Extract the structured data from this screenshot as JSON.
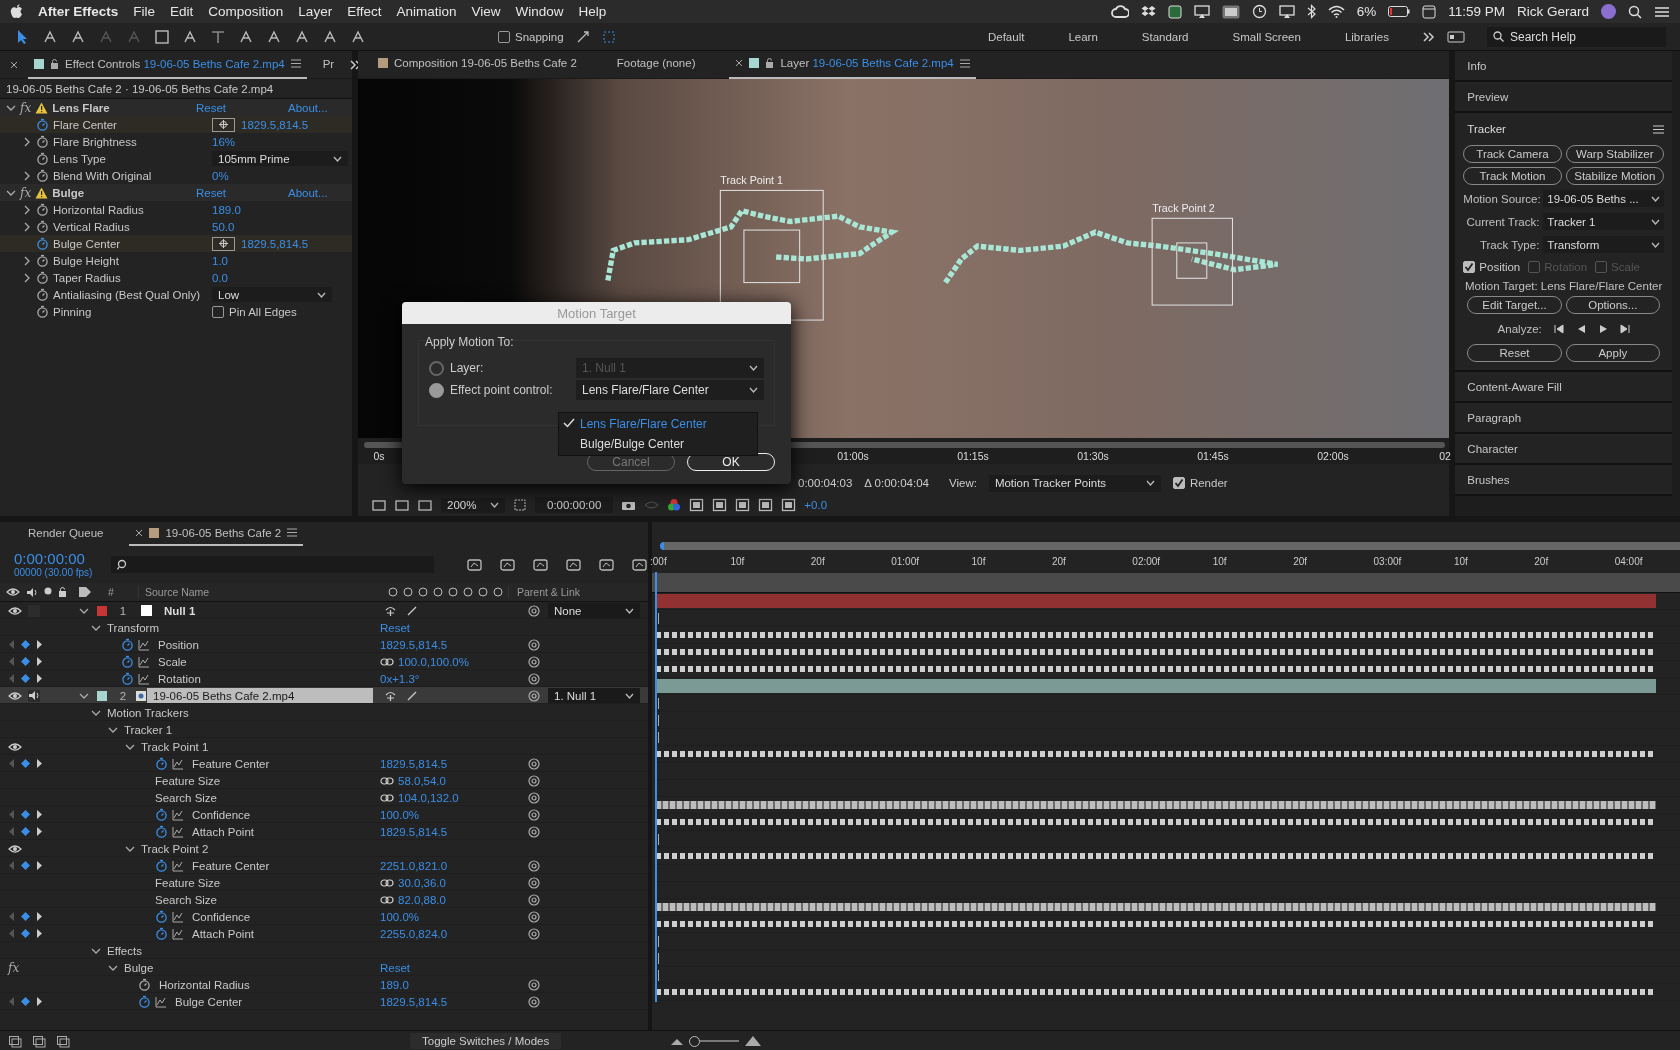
{
  "menu_bar": {
    "app_name": "After Effects",
    "items": [
      "File",
      "Edit",
      "Composition",
      "Layer",
      "Effect",
      "Animation",
      "View",
      "Window",
      "Help"
    ],
    "battery": "6%",
    "clock": "11:59 PM",
    "user": "Rick Gerard"
  },
  "toolbar": {
    "snapping": {
      "label": "Snapping",
      "checked": false
    },
    "workspaces": [
      "Default",
      "Learn",
      "Standard",
      "Small Screen",
      "Libraries"
    ],
    "search": {
      "placeholder": "Search Help"
    }
  },
  "effect_controls": {
    "tab": {
      "label": "Effect Controls",
      "clip": "19-06-05 Beths Cafe 2.mp4"
    },
    "next_tab": "Pr",
    "breadcrumb": "19-06-05 Beths Cafe 2 · 19-06-05 Beths Cafe 2.mp4",
    "effects": [
      {
        "badge": "fx",
        "name": "Lens Flare",
        "expanded": true,
        "reset": "Reset",
        "about": "About...",
        "properties": [
          {
            "kind": "point",
            "name": "Flare Center",
            "value": "1829.5,814.5",
            "animated": true
          },
          {
            "kind": "number",
            "name": "Flare Brightness",
            "value": "16%",
            "animated": false
          },
          {
            "kind": "select",
            "name": "Lens Type",
            "value": "105mm Prime",
            "animated": false
          },
          {
            "kind": "number",
            "name": "Blend With Original",
            "value": "0%",
            "animated": false
          }
        ]
      },
      {
        "badge": "fx",
        "name": "Bulge",
        "expanded": true,
        "reset": "Reset",
        "about": "About...",
        "properties": [
          {
            "kind": "number",
            "name": "Horizontal Radius",
            "value": "189.0",
            "animated": false
          },
          {
            "kind": "number",
            "name": "Vertical Radius",
            "value": "50.0",
            "animated": false
          },
          {
            "kind": "point",
            "name": "Bulge Center",
            "value": "1829.5,814.5",
            "animated": true
          },
          {
            "kind": "number",
            "name": "Bulge Height",
            "value": "1.0",
            "animated": false
          },
          {
            "kind": "number",
            "name": "Taper Radius",
            "value": "0.0",
            "animated": false
          },
          {
            "kind": "select",
            "name": "Antialiasing (Best Qual Only)",
            "value": "Low",
            "animated": false
          },
          {
            "kind": "checkbox",
            "name": "Pinning",
            "value": "Pin All Edges",
            "checked": false,
            "animated": false
          }
        ]
      }
    ]
  },
  "viewer": {
    "tabs": [
      {
        "kind": "composition",
        "label": "Composition 19-06-05 Beths Cafe 2",
        "selected": false
      },
      {
        "kind": "footage",
        "label": "Footage (none)",
        "selected": false
      },
      {
        "kind": "layer",
        "label": "Layer",
        "clip": "19-06-05 Beths Cafe 2.mp4",
        "selected": true
      }
    ],
    "track_points": [
      {
        "label": "Track Point 1"
      },
      {
        "label": "Track Point 2"
      }
    ],
    "ruler": [
      "0s",
      "01:00s",
      "01:15s",
      "01:30s",
      "01:45s",
      "02:00s",
      "02"
    ],
    "info": {
      "current": "0:00:04:03",
      "duration": "Δ 0:00:04:04",
      "view_label": "View:",
      "view": "Motion Tracker Points",
      "render": {
        "label": "Render",
        "checked": true
      }
    },
    "toolbar": {
      "zoom": "200%",
      "timecode": "0:00:00:00",
      "exposure": "+0.0"
    }
  },
  "dialog": {
    "title": "Motion Target",
    "group_label": "Apply Motion To:",
    "options": [
      {
        "label": "Layer:",
        "selected": false,
        "disabled": true,
        "value": "1. Null 1"
      },
      {
        "label": "Effect point control:",
        "selected": true,
        "disabled": false,
        "value": "Lens Flare/Flare Center"
      }
    ],
    "menu": [
      {
        "label": "Lens Flare/Flare Center",
        "selected": true
      },
      {
        "label": "Bulge/Bulge Center",
        "selected": false
      }
    ],
    "buttons": [
      {
        "label": "Cancel",
        "default": false
      },
      {
        "label": "OK",
        "default": true
      }
    ]
  },
  "right_panel": {
    "sections_top": [
      "Info",
      "Preview"
    ],
    "tracker": {
      "title": "Tracker",
      "buttons": [
        "Track Camera",
        "Warp Stabilizer",
        "Track Motion",
        "Stabilize Motion"
      ],
      "fields": [
        {
          "label": "Motion Source:",
          "value": "19-06-05 Beths ..."
        },
        {
          "label": "Current Track:",
          "value": "Tracker 1"
        },
        {
          "label": "Track Type:",
          "value": "Transform"
        }
      ],
      "channels": [
        {
          "label": "Position",
          "checked": true,
          "disabled": false
        },
        {
          "label": "Rotation",
          "checked": false,
          "disabled": true
        },
        {
          "label": "Scale",
          "checked": false,
          "disabled": true
        }
      ],
      "motion_target": "Motion Target: Lens Flare/Flare Center",
      "target_buttons": [
        "Edit Target...",
        "Options..."
      ],
      "analyze_label": "Analyze:",
      "actions": [
        "Reset",
        "Apply"
      ]
    },
    "sections_bottom": [
      "Content-Aware Fill",
      "Paragraph",
      "Character",
      "Brushes"
    ]
  },
  "timeline": {
    "tabs": [
      {
        "label": "Render Queue",
        "selected": false
      },
      {
        "label": "19-06-05 Beths Cafe 2",
        "selected": true
      }
    ],
    "timecode": "0:00:00:00",
    "frame_info": "00000 (30.00 fps)",
    "columns": [
      "#",
      "Source Name",
      "Parent & Link"
    ],
    "ruler": [
      ":00f",
      "10f",
      "20f",
      "01:00f",
      "10f",
      "20f",
      "02:00f",
      "10f",
      "20f",
      "03:00f",
      "10f",
      "20f",
      "04:00f"
    ],
    "layers": [
      {
        "number": "1",
        "name": "Null 1",
        "kind": "null",
        "color": "#c83535",
        "selected": false,
        "audio": false,
        "parent": "None",
        "expanded": true,
        "children": [
          {
            "label": "Transform",
            "value": "Reset",
            "expanded": true,
            "children": [
              {
                "kind": "animated",
                "label": "Position",
                "value": "1829.5,814.5",
                "linked": false
              },
              {
                "kind": "animated",
                "label": "Scale",
                "value": "100.0,100.0%",
                "linked": true
              },
              {
                "kind": "animated",
                "label": "Rotation",
                "value": "0x+1.3°",
                "linked": false
              }
            ]
          }
        ]
      },
      {
        "number": "2",
        "name": "19-06-05 Beths Cafe 2.mp4",
        "kind": "footage",
        "color": "#a6d6cf",
        "selected": true,
        "audio": true,
        "parent": "1. Null 1",
        "expanded": true,
        "children": [
          {
            "label": "Motion Trackers",
            "expanded": true,
            "children": [
              {
                "label": "Tracker 1",
                "expanded": true,
                "children": [
                  {
                    "label": "Track Point 1",
                    "visible": true,
                    "expanded": true,
                    "children": [
                      {
                        "kind": "animated",
                        "label": "Feature Center",
                        "value": "1829.5,814.5",
                        "linked": false
                      },
                      {
                        "kind": "size",
                        "label": "Feature Size",
                        "value": "58.0,54.0",
                        "linked": true
                      },
                      {
                        "kind": "size",
                        "label": "Search Size",
                        "value": "104.0,132.0",
                        "linked": true
                      },
                      {
                        "kind": "confidence",
                        "label": "Confidence",
                        "value": "100.0%",
                        "linked": false
                      },
                      {
                        "kind": "animated",
                        "label": "Attach Point",
                        "value": "1829.5,814.5",
                        "linked": false
                      }
                    ]
                  },
                  {
                    "label": "Track Point 2",
                    "visible": true,
                    "expanded": true,
                    "children": [
                      {
                        "kind": "animated",
                        "label": "Feature Center",
                        "value": "2251.0,821.0",
                        "linked": false
                      },
                      {
                        "kind": "size",
                        "label": "Feature Size",
                        "value": "30.0,36.0",
                        "linked": true
                      },
                      {
                        "kind": "size",
                        "label": "Search Size",
                        "value": "82.0,88.0",
                        "linked": true
                      },
                      {
                        "kind": "confidence",
                        "label": "Confidence",
                        "value": "100.0%",
                        "linked": false
                      },
                      {
                        "kind": "animated",
                        "label": "Attach Point",
                        "value": "2255.0,824.0",
                        "linked": false
                      }
                    ]
                  }
                ]
              }
            ]
          },
          {
            "label": "Effects",
            "expanded": true,
            "children": [
              {
                "label": "Bulge",
                "badge": "fx",
                "value": "Reset",
                "expanded": true,
                "children": [
                  {
                    "kind": "static",
                    "label": "Horizontal Radius",
                    "value": "189.0",
                    "linked": false
                  },
                  {
                    "kind": "animated",
                    "label": "Bulge Center",
                    "value": "1829.5,814.5",
                    "linked": false
                  }
                ]
              }
            ]
          }
        ]
      }
    ],
    "footer": "Toggle Switches / Modes",
    "zoom_slider": {
      "level": 0.1
    }
  }
}
